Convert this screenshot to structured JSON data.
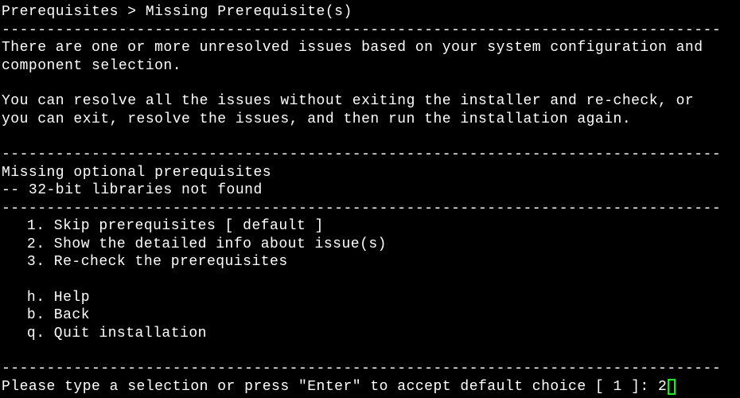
{
  "breadcrumb": "Prerequisites > Missing Prerequisite(s)",
  "divider": "--------------------------------------------------------------------------------",
  "intro_line1": "There are one or more unresolved issues based on your system configuration and",
  "intro_line2": "component selection.",
  "intro_line3": "You can resolve all the issues without exiting the installer and re-check, or",
  "intro_line4": "you can exit, resolve the issues, and then run the installation again.",
  "section_title": "Missing optional prerequisites",
  "section_item": "-- 32-bit libraries not found",
  "menu": {
    "opt1": "   1. Skip prerequisites [ default ]",
    "opt2": "   2. Show the detailed info about issue(s)",
    "opt3": "   3. Re-check the prerequisites",
    "help": "   h. Help",
    "back": "   b. Back",
    "quit": "   q. Quit installation"
  },
  "prompt": {
    "text": "Please type a selection or press \"Enter\" to accept default choice [ 1 ]: ",
    "input_value": "2"
  }
}
